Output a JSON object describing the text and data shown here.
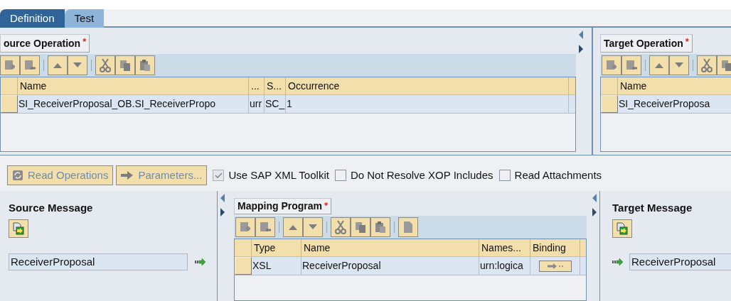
{
  "tabs": [
    {
      "label": "Definition",
      "selected": true
    },
    {
      "label": "Test",
      "selected": false
    }
  ],
  "source_operation": {
    "title": "ource Operation",
    "marker": "*",
    "columns": [
      "Name",
      "...",
      "S...",
      "Occurrence"
    ],
    "rows": [
      [
        "SI_ReceiverProposal_OB.SI_ReceiverPropo",
        "urr",
        "SC_",
        "1"
      ]
    ]
  },
  "target_operation": {
    "title": "Target Operation",
    "marker": "*",
    "columns": [
      "Name"
    ],
    "rows": [
      [
        "SI_ReceiverProposa"
      ]
    ]
  },
  "actions": [
    {
      "label": "Read Operations",
      "disabled": true
    },
    {
      "label": "Parameters...",
      "disabled": true
    }
  ],
  "options": [
    {
      "label": "Use SAP XML Toolkit",
      "checked": true,
      "disabled": true
    },
    {
      "label": "Do Not Resolve XOP Includes",
      "checked": false,
      "disabled": false
    },
    {
      "label": "Read Attachments",
      "checked": false,
      "disabled": false
    }
  ],
  "source_message": {
    "title": "Source Message",
    "value": "ReceiverProposal"
  },
  "mapping_program": {
    "title": "Mapping Program",
    "marker": "*",
    "columns": [
      "Type",
      "Name",
      "Names...",
      "Binding"
    ],
    "rows": [
      [
        "XSL",
        "ReceiverProposal",
        "urn:logica"
      ]
    ]
  },
  "target_message": {
    "title": "Target Message",
    "value": "ReceiverProposal"
  }
}
